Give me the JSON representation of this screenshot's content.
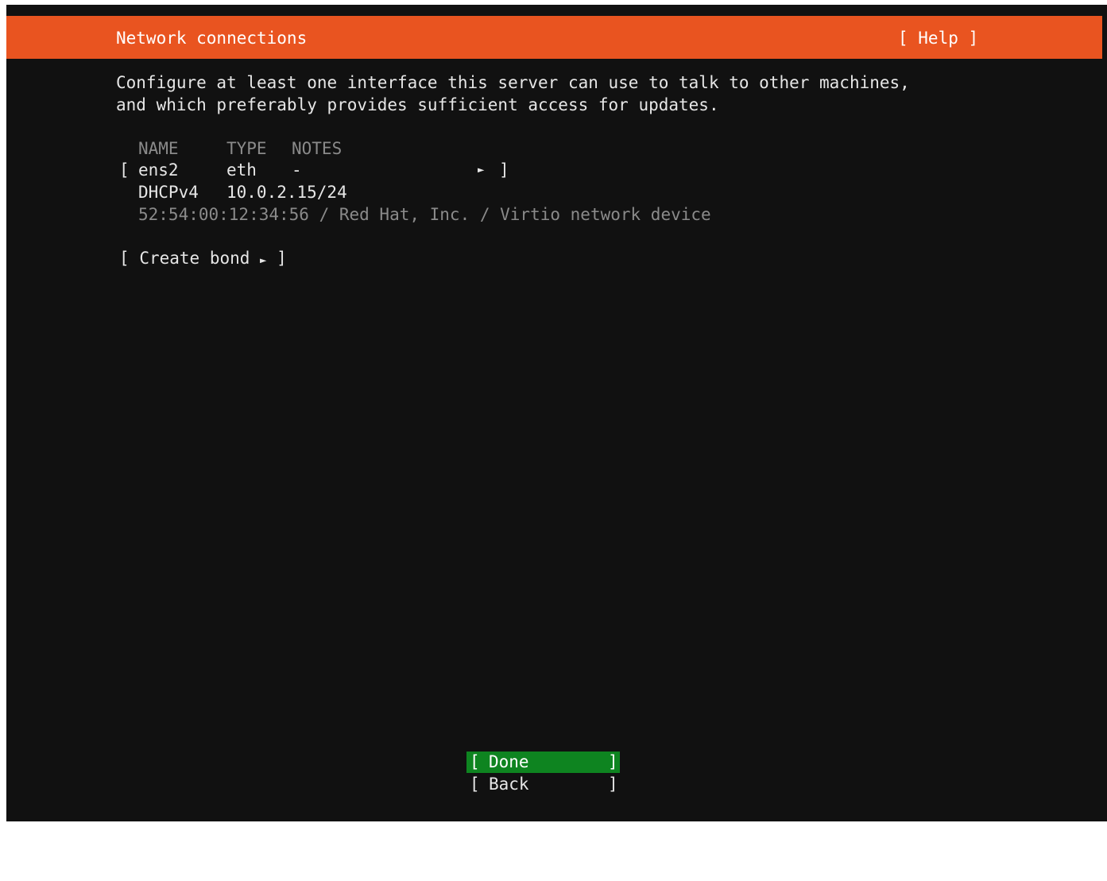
{
  "header": {
    "title": "Network connections",
    "help_label": "[ Help ]"
  },
  "description": {
    "line1": "Configure at least one interface this server can use to talk to other machines,",
    "line2": "and which preferably provides sufficient access for updates."
  },
  "table": {
    "columns": [
      "NAME",
      "TYPE",
      "NOTES"
    ],
    "rows": [
      {
        "name": "ens2",
        "type": "eth",
        "notes": "-",
        "arrow": "►",
        "dhcp_label": "DHCPv4",
        "address": "10.0.2.15/24",
        "hardware": "52:54:00:12:34:56 / Red Hat, Inc. / Virtio network device"
      }
    ]
  },
  "bracket_open": "[",
  "bracket_close": "]",
  "create_bond": {
    "label": "Create bond",
    "arrow": "►"
  },
  "buttons": {
    "done": "Done",
    "back": "Back"
  },
  "colors": {
    "header_bg": "#e95420",
    "screen_bg": "#111111",
    "done_bg": "#0e8420",
    "dim_text": "#8a8a8a"
  },
  "icons": {
    "row_arrow": "right-triangle-icon",
    "bond_arrow": "right-triangle-icon"
  }
}
